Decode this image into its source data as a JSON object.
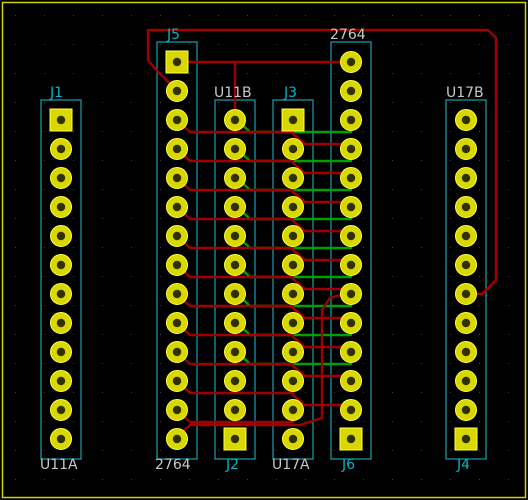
{
  "colors": {
    "background": "#000000",
    "board_edge": "#d2d200",
    "courtyard": "#1aa0b0",
    "pad_fill": "#d8d800",
    "pad_hole": "#303000",
    "pad_ring": "#ffff40",
    "track_front": "#a00000",
    "track_back": "#00a000",
    "grid_dot": "#404040",
    "label_ref": "#00b8c8",
    "label_value": "#c8c8c8"
  },
  "footprints": [
    {
      "name": "j1",
      "reference": "J1",
      "value": "U11A",
      "pins": 12
    },
    {
      "name": "j5",
      "reference": "J5",
      "value": "2764",
      "pins": 14
    },
    {
      "name": "j2",
      "reference": "J2",
      "value": "U11B",
      "pins": 12
    },
    {
      "name": "j3",
      "reference": "J3",
      "value": "U17A",
      "pins": 12
    },
    {
      "name": "j6",
      "reference": "J6",
      "value": "2764",
      "pins": 14
    },
    {
      "name": "j4",
      "reference": "J4",
      "value": "U17B",
      "pins": 12
    }
  ]
}
